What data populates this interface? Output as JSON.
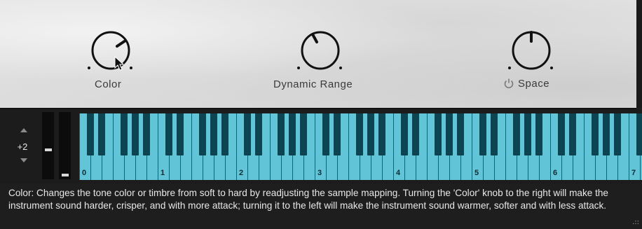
{
  "knobs": [
    {
      "id": "color",
      "label": "Color",
      "value": 0.75
    },
    {
      "id": "dynamic-range",
      "label": "Dynamic Range",
      "value": 0.42
    },
    {
      "id": "space",
      "label": "Space",
      "value": 0.5,
      "has_power_toggle": true
    }
  ],
  "transpose": {
    "value": "+2"
  },
  "keyboard": {
    "octave_labels": [
      "0",
      "1",
      "2",
      "3",
      "4",
      "5",
      "6",
      "7"
    ],
    "key_color": "#62c4d7",
    "black_key_color": "#0d4452"
  },
  "info": {
    "text": "Color: Changes the tone color or timbre from soft to hard by readjusting the sample mapping. Turning the 'Color' knob to the right will make the instrument sound harder, crisper, and with more attack; turning it to the left will make the instrument sound warmer, softer and with less attack."
  },
  "icons": {
    "power": "power-icon",
    "resize": "resize-grip-icon",
    "cursor": "mouse-cursor-icon"
  }
}
